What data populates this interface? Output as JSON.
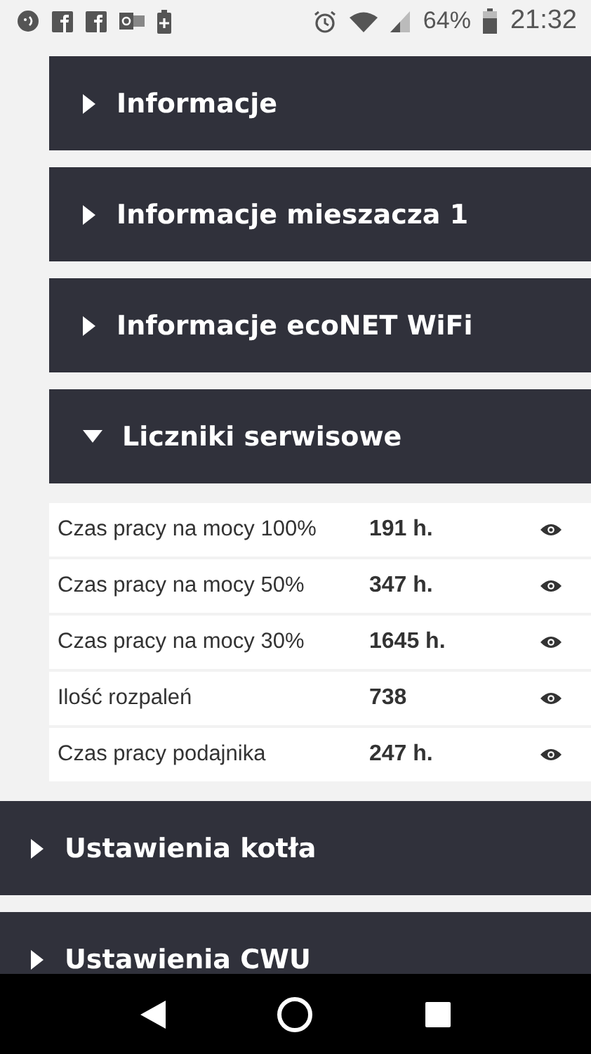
{
  "status_bar": {
    "battery": "64%",
    "time": "21:32"
  },
  "sections": [
    {
      "title": "Informacje",
      "expanded": false
    },
    {
      "title": "Informacje mieszacza 1",
      "expanded": false
    },
    {
      "title": "Informacje ecoNET WiFi",
      "expanded": false
    },
    {
      "title": "Liczniki serwisowe",
      "expanded": true
    }
  ],
  "counters": [
    {
      "label": "Czas pracy na mocy 100%",
      "value": "191 h."
    },
    {
      "label": "Czas pracy na mocy 50%",
      "value": "347 h."
    },
    {
      "label": "Czas pracy na mocy 30%",
      "value": "1645 h."
    },
    {
      "label": "Ilość rozpaleń",
      "value": "738"
    },
    {
      "label": "Czas pracy podajnika",
      "value": "247 h."
    }
  ],
  "main_sections": [
    {
      "title": "Ustawienia kotła",
      "expanded": false
    },
    {
      "title": "Ustawienia CWU",
      "expanded": false
    }
  ]
}
